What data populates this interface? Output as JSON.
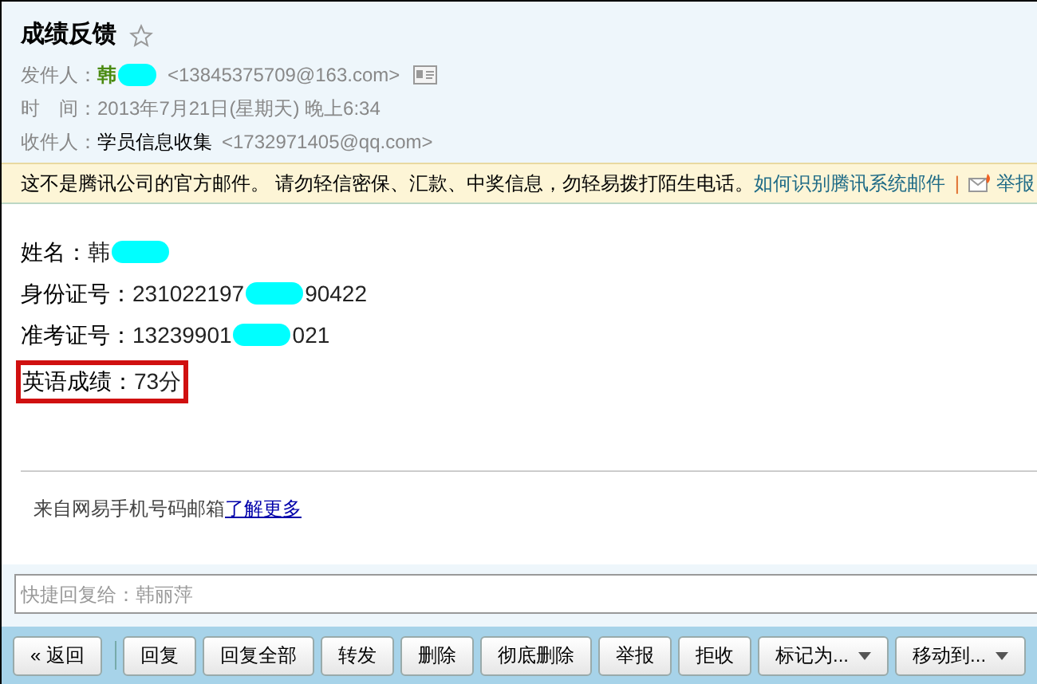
{
  "subject": "成绩反馈",
  "header": [
    {
      "kind": "sender",
      "label": "发件人：",
      "name": "韩",
      "address": "<13845375709@163.com>"
    },
    {
      "kind": "plain",
      "label": "时　间：",
      "value": "2013年7月21日(星期天) 晚上6:34"
    },
    {
      "kind": "recipient",
      "label": "收件人：",
      "name": "学员信息收集",
      "address": "<1732971405@qq.com>"
    }
  ],
  "warning": {
    "text": "这不是腾讯公司的官方邮件。 请勿轻信密保、汇款、中奖信息，勿轻易拨打陌生电话。",
    "link": "如何识别腾讯系统邮件",
    "separator": "|",
    "report": "举报"
  },
  "body": [
    {
      "label": "姓名：",
      "before": "韩",
      "redacted": true,
      "highlighted": false
    },
    {
      "label": "身份证号：",
      "before": "231022197",
      "redacted": true,
      "after": "90422",
      "highlighted": false
    },
    {
      "label": "准考证号：",
      "before": "13239901",
      "redacted": true,
      "after": "021",
      "highlighted": false
    },
    {
      "label": "英语成绩：",
      "before": "73分",
      "redacted": false,
      "highlighted": true
    }
  ],
  "signature": {
    "text": "来自网易手机号码邮箱",
    "link": "了解更多"
  },
  "quick_reply": {
    "placeholder": "快捷回复给：韩丽萍"
  },
  "toolbar": [
    {
      "label": "« 返回",
      "dropdown": false
    },
    {
      "label": "回复",
      "dropdown": false
    },
    {
      "label": "回复全部",
      "dropdown": false
    },
    {
      "label": "转发",
      "dropdown": false
    },
    {
      "label": "删除",
      "dropdown": false
    },
    {
      "label": "彻底删除",
      "dropdown": false
    },
    {
      "label": "举报",
      "dropdown": false
    },
    {
      "label": "拒收",
      "dropdown": false
    },
    {
      "label": "标记为...",
      "dropdown": true
    },
    {
      "label": "移动到...",
      "dropdown": true
    }
  ]
}
